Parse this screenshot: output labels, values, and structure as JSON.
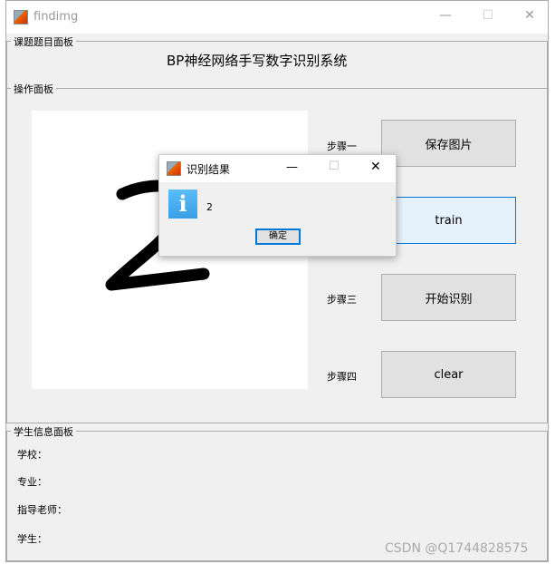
{
  "window": {
    "title": "findimg",
    "minimize": "—",
    "maximize": "☐",
    "close": "✕"
  },
  "title_panel": {
    "label": "课题题目面板",
    "heading": "BP神经网络手写数字识别系统"
  },
  "op_panel": {
    "label": "操作面板",
    "steps": [
      {
        "label": "步骤一",
        "button": "保存图片"
      },
      {
        "button": "train"
      },
      {
        "label": "步骤三",
        "button": "开始识别"
      },
      {
        "label": "步骤四",
        "button": "clear"
      }
    ]
  },
  "student_panel": {
    "label": "学生信息面板",
    "fields": [
      "学校：",
      "专业：",
      "指导老师：",
      "学生："
    ]
  },
  "dialog": {
    "title": "识别结果",
    "message": "2",
    "ok": "确定",
    "icon": "info-icon",
    "minimize": "—",
    "maximize": "☐",
    "close": "✕"
  },
  "watermark": "CSDN @Q1744828575"
}
